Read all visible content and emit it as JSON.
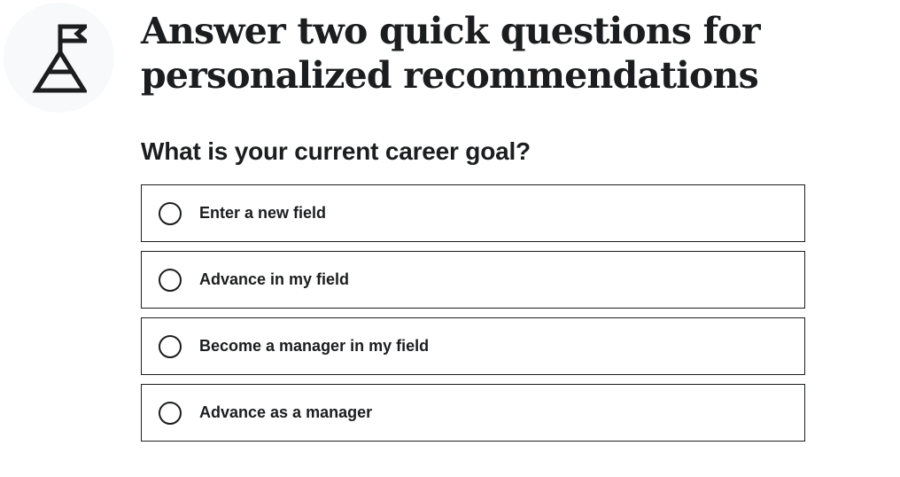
{
  "header": {
    "icon": "summit-flag-icon",
    "title": "Answer two quick questions for personalized recommendations"
  },
  "question": {
    "text": "What is your current career goal?",
    "options": [
      {
        "label": "Enter a new field",
        "selected": false
      },
      {
        "label": "Advance in my field",
        "selected": false
      },
      {
        "label": "Become a manager in my field",
        "selected": false
      },
      {
        "label": "Advance as a manager",
        "selected": false
      }
    ]
  },
  "colors": {
    "text": "#1c1d1f",
    "icon_bg": "#f7f9fa",
    "border": "#1c1d1f"
  }
}
